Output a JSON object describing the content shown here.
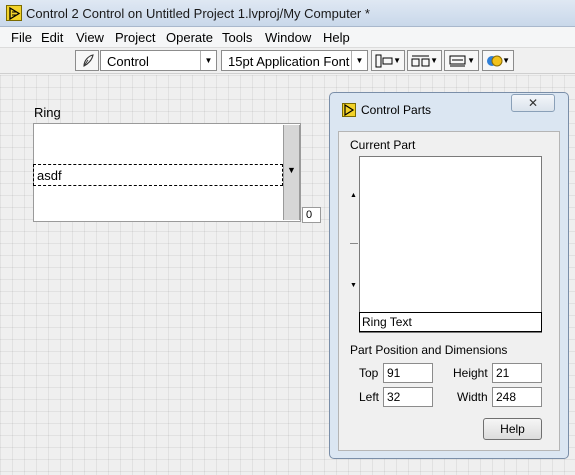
{
  "window": {
    "title": "Control 2 Control on Untitled Project 1.lvproj/My Computer *"
  },
  "menubar": {
    "items": [
      "File",
      "Edit",
      "View",
      "Project",
      "Operate",
      "Tools",
      "Window",
      "Help"
    ]
  },
  "toolbar": {
    "mode_value": "Control",
    "font_value": "15pt Application Font",
    "icons": [
      "edit-mode-icon",
      "align-objects-icon",
      "distribute-objects-icon",
      "resize-objects-icon",
      "reorder-icon"
    ]
  },
  "ring": {
    "label": "Ring",
    "text": "asdf",
    "index": "0"
  },
  "control_parts": {
    "title": "Control Parts",
    "current_part_heading": "Current Part",
    "current_part_name": "Ring Text",
    "dimensions_heading": "Part Position and Dimensions",
    "top_label": "Top",
    "top_value": "91",
    "height_label": "Height",
    "height_value": "21",
    "left_label": "Left",
    "left_value": "32",
    "width_label": "Width",
    "width_value": "248",
    "help_label": "Help"
  },
  "colors": {
    "title_bar": "#c9d8ea",
    "labview_icon": "#f2d229",
    "canvas": "#efefef"
  }
}
